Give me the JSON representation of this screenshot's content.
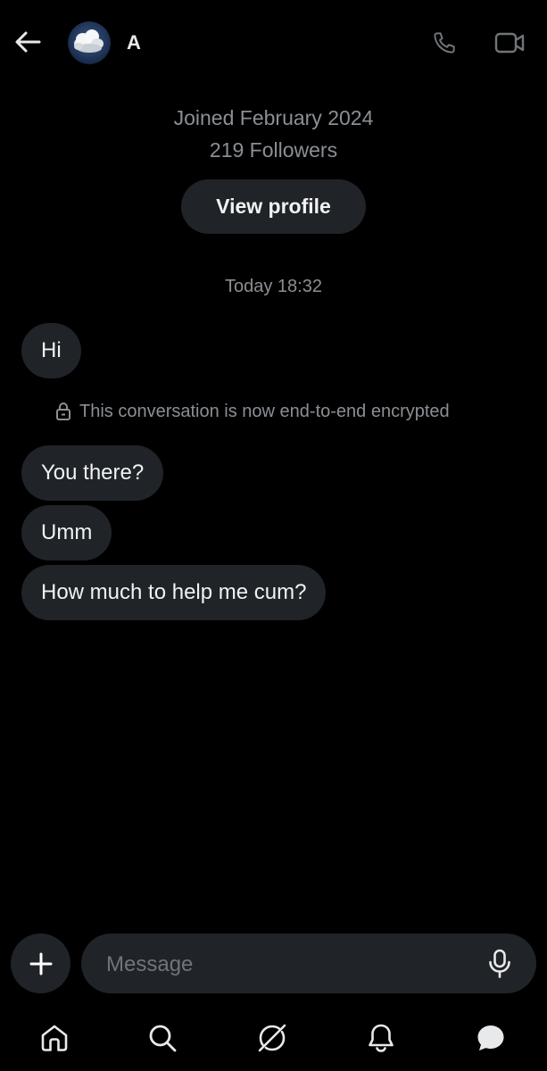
{
  "header": {
    "contact_name": "A"
  },
  "profile": {
    "joined": "Joined February 2024",
    "followers": "219 Followers",
    "view_profile_label": "View profile"
  },
  "conversation": {
    "timestamp": "Today 18:32",
    "encryption_notice": "This conversation is now end-to-end encrypted",
    "messages": [
      {
        "text": "Hi"
      },
      {
        "text": "You there?"
      },
      {
        "text": "Umm"
      },
      {
        "text": "How much to help me cum?"
      }
    ]
  },
  "composer": {
    "placeholder": "Message"
  },
  "nav": {
    "items": [
      "home-icon",
      "search-icon",
      "grok-icon",
      "notifications-icon",
      "messages-icon"
    ]
  },
  "colors": {
    "background": "#000000",
    "bubble": "#202327",
    "muted_text": "#8b8f94",
    "text": "#e7e9ea"
  }
}
